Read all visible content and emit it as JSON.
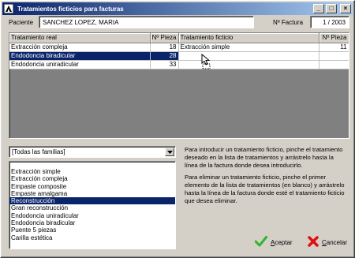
{
  "window": {
    "title": "Tratamientos ficticios para facturas",
    "controls": {
      "minimize": "_",
      "maximize": "□",
      "close": "×"
    }
  },
  "header": {
    "paciente_label": "Paciente",
    "paciente_value": "SANCHEZ LOPEZ, MARIA",
    "factura_label": "Nº Factura",
    "factura_value": "1 / 2003"
  },
  "grid": {
    "columns": [
      "Tratamiento real",
      "Nº Pieza",
      "Tratamiento ficticio",
      "Nº Pieza"
    ],
    "rows": [
      {
        "real": "Extracción compleja",
        "pieza_real": "18",
        "ficticio": "Extracción simple",
        "pieza_ficticio": "11"
      },
      {
        "real": "Endodoncia biradicular",
        "pieza_real": "28",
        "ficticio": "",
        "pieza_ficticio": ""
      },
      {
        "real": "Endodoncia uniradicular",
        "pieza_real": "33",
        "ficticio": "",
        "pieza_ficticio": ""
      }
    ],
    "selected_row": 1
  },
  "family_filter": {
    "selected": "[Todas las familias]"
  },
  "treatments_list": {
    "items": [
      "Extracción simple",
      "Extracción compleja",
      "Empaste composite",
      "Empaste amalgama",
      "Reconstrucción",
      "Gran reconstrucción",
      "Endodoncia uniradicular",
      "Endodoncia biradicular",
      "Puente 5 piezas",
      "Carilla estética"
    ],
    "selected_index": 4
  },
  "help": {
    "paragraph1": "Para introducir un tratamiento ficticio, pinche el tratamiento deseado en la lista de tratamientos y arrástrelo hasta la línea de la factura donde desea introducirlo.",
    "paragraph2": "Para eliminar un tratamiento ficticio, pinche el primer elemento de la lista de tratamientos (en blanco) y arrástrelo hasta la línea de la factura donde esté el tratamiento ficticio que desea eliminar."
  },
  "buttons": {
    "accept_underline": "A",
    "accept_rest": "ceptar",
    "cancel_underline": "C",
    "cancel_rest": "ancelar"
  },
  "colors": {
    "titlebar_start": "#0a246a",
    "titlebar_end": "#a6caf0",
    "selection": "#0a246a",
    "accept_icon": "#2fb52f",
    "cancel_icon": "#e01010"
  },
  "icons": {
    "app": "dental-app-icon",
    "accept": "check-icon",
    "cancel": "x-icon",
    "dropdown": "chevron-down-icon",
    "cursor": "drag-cursor-icon"
  }
}
